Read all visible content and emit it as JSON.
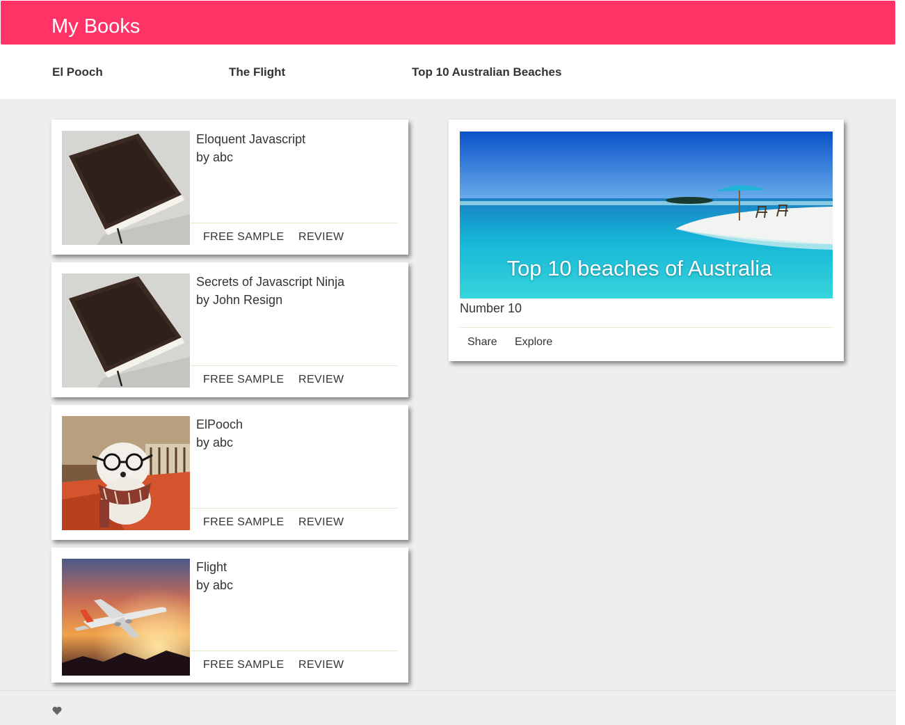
{
  "header": {
    "title": "My Books",
    "color": "#ff3366"
  },
  "nav": {
    "links": [
      {
        "label": "El Pooch"
      },
      {
        "label": "The Flight"
      },
      {
        "label": "Top 10 Australian Beaches"
      }
    ]
  },
  "books": [
    {
      "title": "Eloquent Javascript",
      "author": "by abc",
      "image": "book-cover",
      "actions": [
        "FREE SAMPLE",
        "REVIEW"
      ]
    },
    {
      "title": "Secrets of Javascript Ninja",
      "author": "by John Resign",
      "image": "book-cover",
      "actions": [
        "FREE SAMPLE",
        "REVIEW"
      ]
    },
    {
      "title": "ElPooch",
      "author": "by abc",
      "image": "dog-photo",
      "actions": [
        "FREE SAMPLE",
        "REVIEW"
      ]
    },
    {
      "title": "Flight",
      "author": "by abc",
      "image": "airplane-photo",
      "actions": [
        "FREE SAMPLE",
        "REVIEW"
      ]
    }
  ],
  "feature": {
    "caption": "Top 10 beaches of Australia",
    "subtitle": "Number 10",
    "image": "beach-photo",
    "actions": [
      "Share",
      "Explore"
    ]
  },
  "footer": {
    "icon": "heart-icon"
  }
}
